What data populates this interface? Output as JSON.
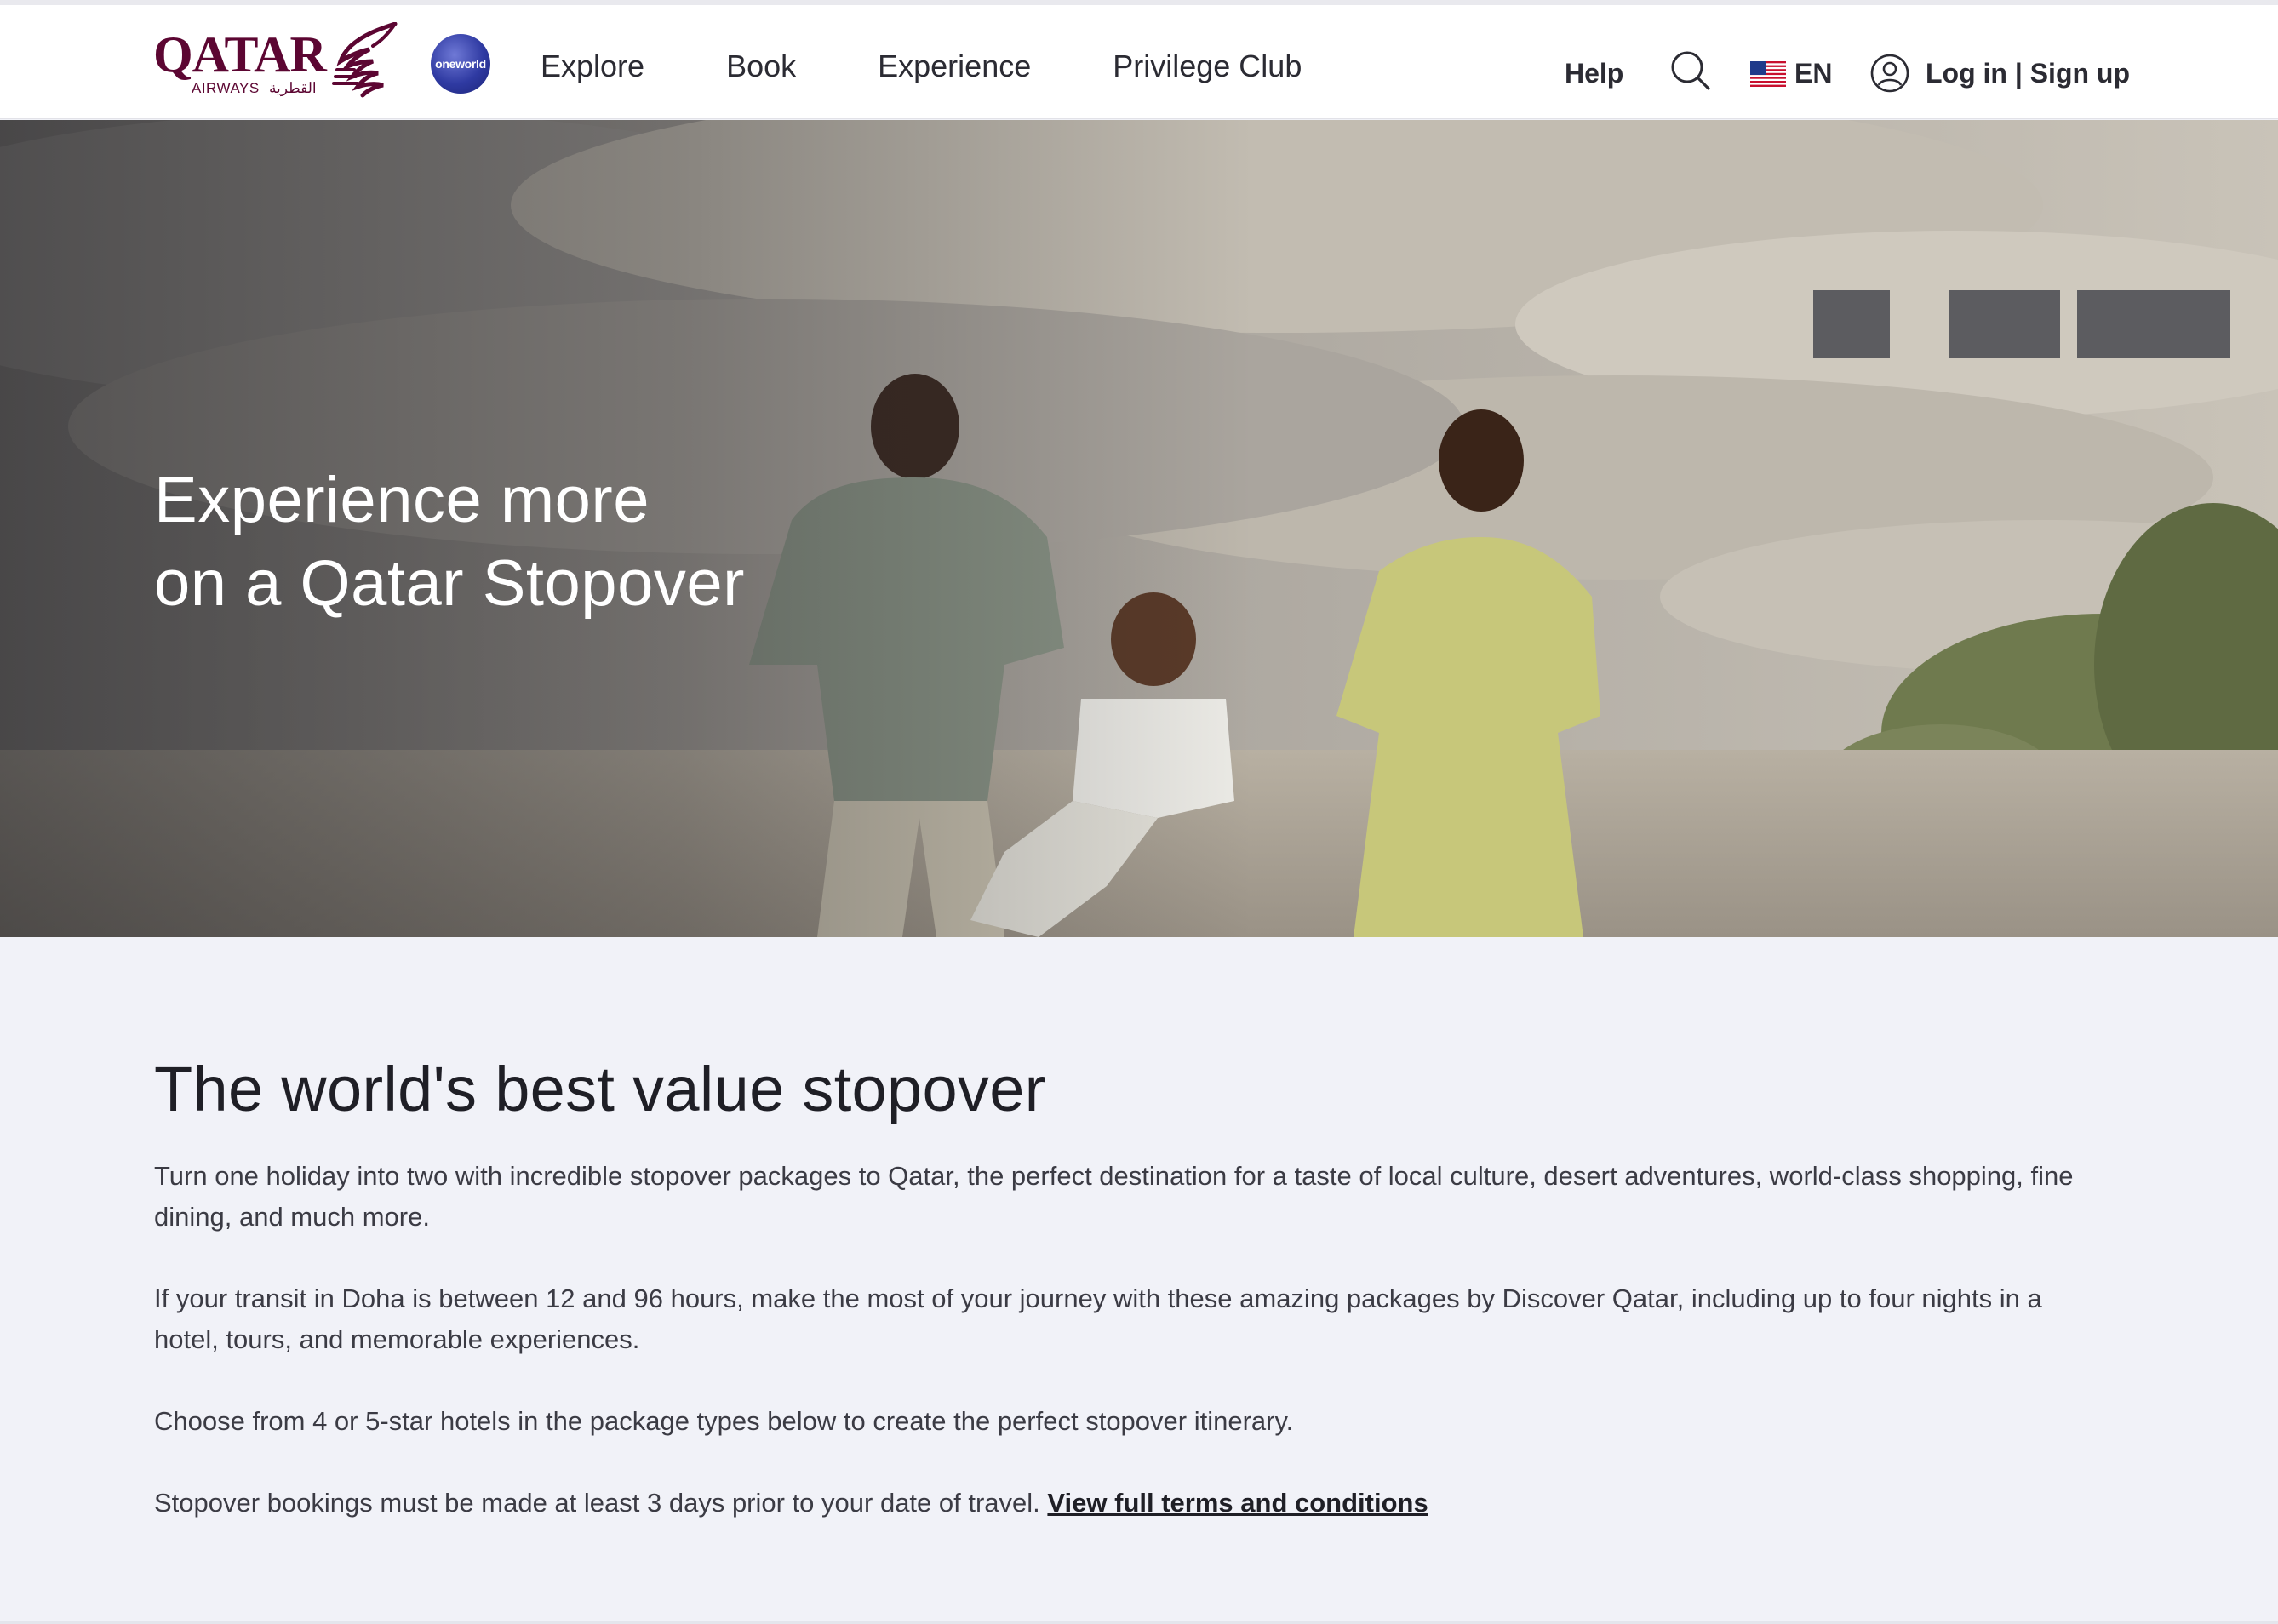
{
  "header": {
    "logo": {
      "wordmark": "QATAR",
      "sub_latin": "AIRWAYS",
      "sub_arabic": "القطرية"
    },
    "alliance_badge": "oneworld",
    "nav": [
      {
        "label": "Explore"
      },
      {
        "label": "Book"
      },
      {
        "label": "Experience"
      },
      {
        "label": "Privilege Club"
      }
    ],
    "help_label": "Help",
    "language_code": "EN",
    "login_label": "Log in | Sign up",
    "icons": {
      "search": "search-icon",
      "flag": "us-flag-icon",
      "user": "user-icon"
    },
    "brand_color": "#5c0632"
  },
  "hero": {
    "title_line1": "Experience more",
    "title_line2": "on a Qatar Stopover"
  },
  "main": {
    "title": "The world's best value stopover",
    "paragraphs": [
      "Turn one holiday into two with incredible stopover packages to Qatar, the perfect destination for a taste of local culture, desert adventures, world-class shopping, fine dining, and much more.",
      "If your transit in Doha is between 12 and 96 hours, make the most of your journey with these amazing packages by Discover Qatar, including up to four nights in a hotel, tours, and memorable experiences.",
      "Choose from 4 or 5-star hotels in the package types below to create the perfect stopover itinerary."
    ],
    "booking_note": "Stopover bookings must be made at least 3 days prior to your date of travel.",
    "terms_link": "View full terms and conditions"
  }
}
